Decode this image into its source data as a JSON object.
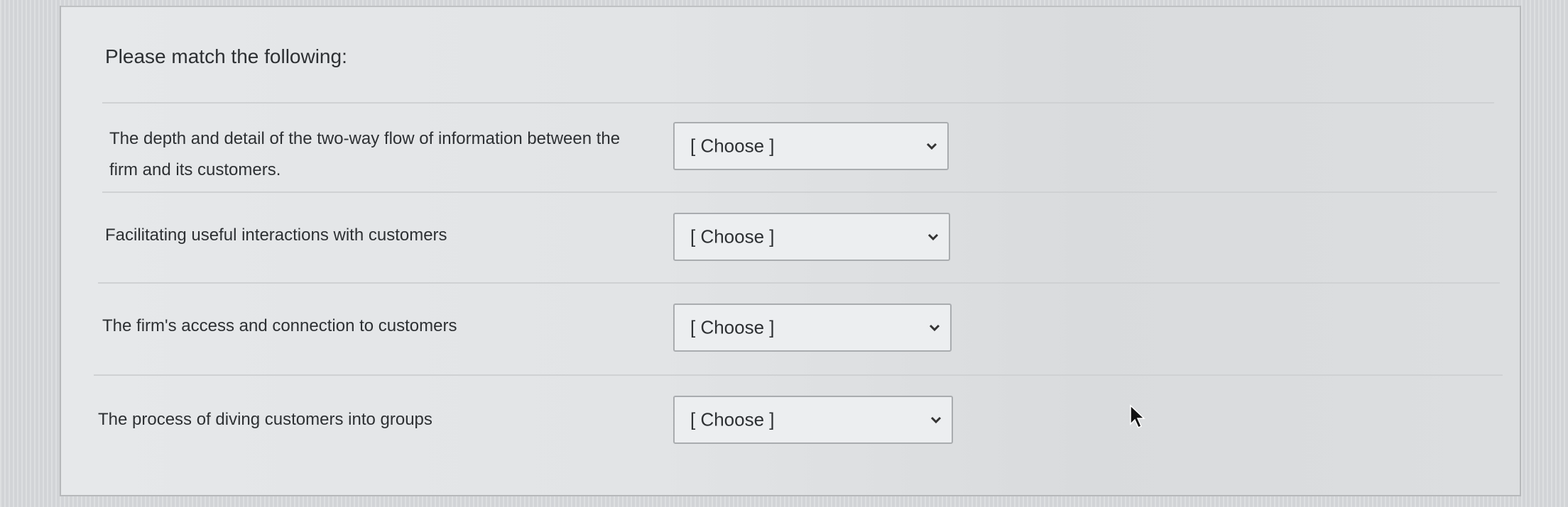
{
  "question": {
    "title": "Please match the following:"
  },
  "items": [
    {
      "prompt_line1": "The depth and detail of the two-way flow of information between the",
      "prompt_line2": "firm and its customers.",
      "selected": "[ Choose ]"
    },
    {
      "prompt_line1": "Facilitating useful interactions with customers",
      "prompt_line2": "",
      "selected": "[ Choose ]"
    },
    {
      "prompt_line1": "The firm's access and connection to customers",
      "prompt_line2": "",
      "selected": "[ Choose ]"
    },
    {
      "prompt_line1": "The process of diving customers into groups",
      "prompt_line2": "",
      "selected": "[ Choose ]"
    }
  ],
  "icons": {
    "dropdown": "chevron-down-icon",
    "pointer": "mouse-cursor-icon"
  }
}
